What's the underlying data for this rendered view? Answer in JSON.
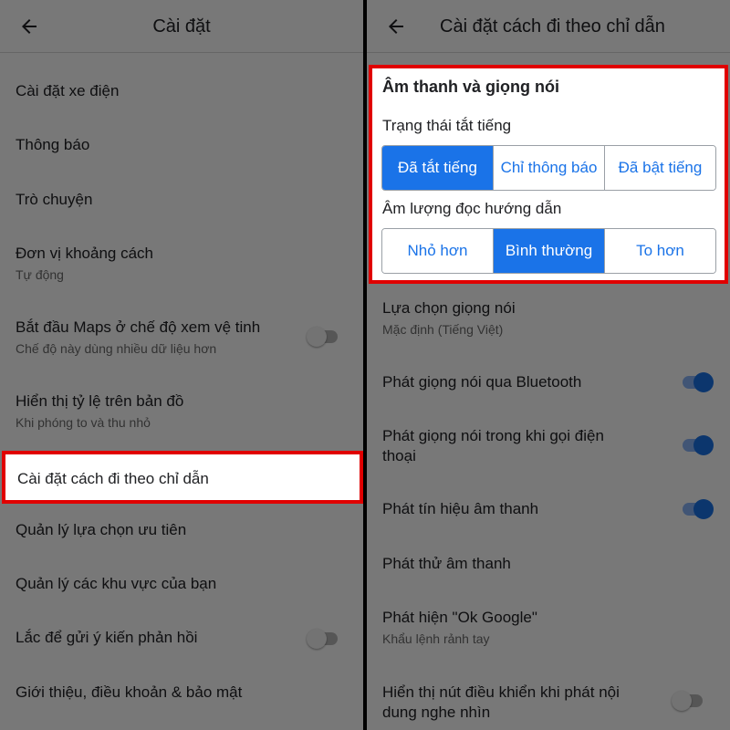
{
  "left": {
    "title": "Cài đặt",
    "items": [
      {
        "title": "Cài đặt xe điện"
      },
      {
        "title": "Thông báo"
      },
      {
        "title": "Trò chuyện"
      },
      {
        "title": "Đơn vị khoảng cách",
        "subtitle": "Tự động"
      },
      {
        "title": "Bắt đầu Maps ở chế độ xem vệ tinh",
        "subtitle": "Chế độ này dùng nhiều dữ liệu hơn",
        "toggle": false
      },
      {
        "title": "Hiển thị tỷ lệ trên bản đồ",
        "subtitle": "Khi phóng to và thu nhỏ"
      },
      {
        "title": "Cài đặt cách đi theo chỉ dẫn"
      },
      {
        "title": "Quản lý lựa chọn ưu tiên"
      },
      {
        "title": "Quản lý các khu vực của bạn"
      },
      {
        "title": "Lắc để gửi ý kiến phản hồi",
        "toggle": false
      },
      {
        "title": "Giới thiệu, điều khoản & bảo mật"
      }
    ]
  },
  "right": {
    "title": "Cài đặt cách đi theo chỉ dẫn",
    "sound_section": {
      "heading": "Âm thanh và giọng nói",
      "mute_label": "Trạng thái tắt tiếng",
      "mute_options": [
        "Đã tắt tiếng",
        "Chỉ thông báo",
        "Đã bật tiếng"
      ],
      "mute_selected": "Đã tắt tiếng",
      "volume_label": "Âm lượng đọc hướng dẫn",
      "volume_options": [
        "Nhỏ hơn",
        "Bình thường",
        "To hơn"
      ],
      "volume_selected": "Bình thường"
    },
    "items": [
      {
        "title": "Lựa chọn giọng nói",
        "subtitle": "Mặc định (Tiếng Việt)"
      },
      {
        "title": "Phát giọng nói qua Bluetooth",
        "toggle": true
      },
      {
        "title": "Phát giọng nói trong khi gọi điện",
        "title2": "thoại",
        "toggle": true
      },
      {
        "title": "Phát tín hiệu âm thanh",
        "toggle": true
      },
      {
        "title": "Phát thử âm thanh"
      },
      {
        "title": "Phát hiện \"Ok Google\"",
        "subtitle": "Khẩu lệnh rảnh tay"
      },
      {
        "title": "Hiển thị nút điều khiển khi phát nội",
        "title2": "dung nghe nhìn",
        "toggle": false
      }
    ]
  },
  "colors": {
    "accent": "#1a73e8",
    "highlight": "#e00000"
  },
  "icons": {
    "back": "arrow-back-icon"
  }
}
